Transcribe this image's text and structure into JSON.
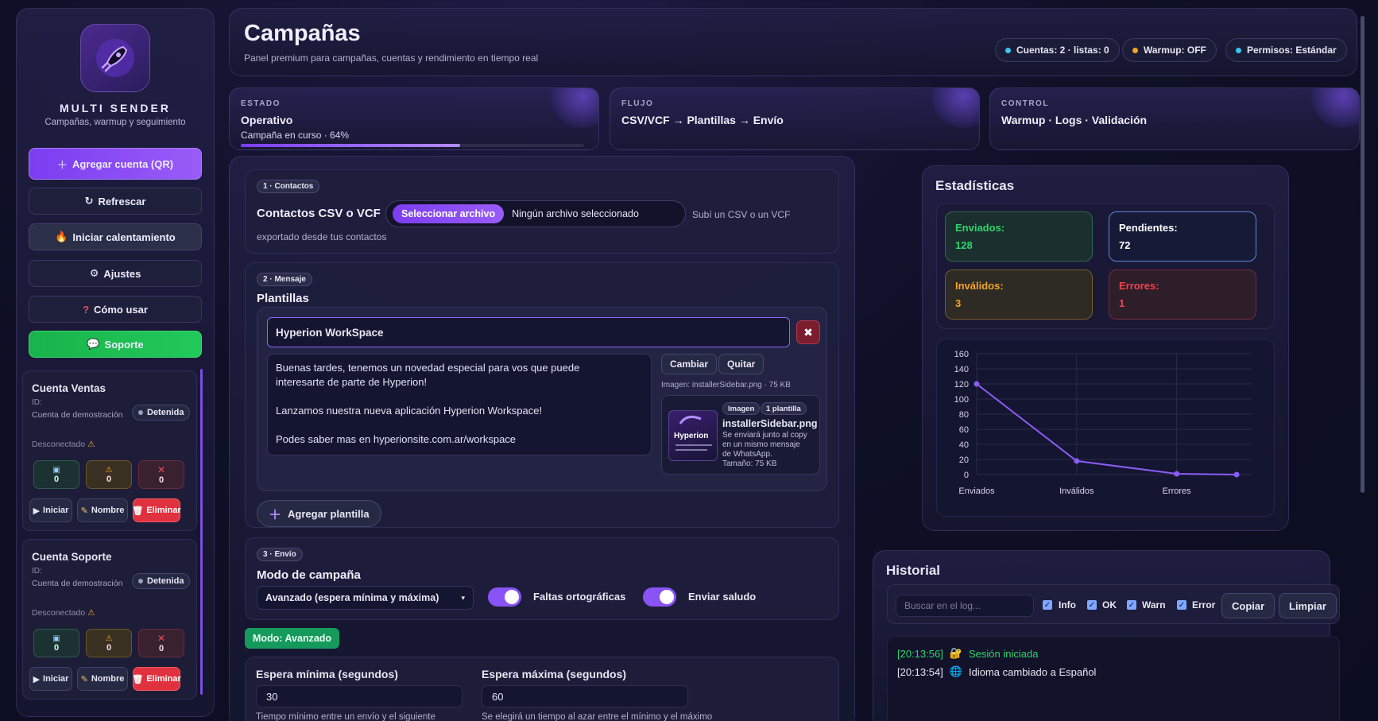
{
  "sidebar": {
    "brand": "MULTI SENDER",
    "brand_sub": "Campañas, warmup y seguimiento",
    "buttons": {
      "add_account": "Agregar cuenta (QR)",
      "refresh": "Refrescar",
      "warmup": "Iniciar calentamiento",
      "settings": "Ajustes",
      "how_to": "Cómo usar",
      "support": "Soporte"
    },
    "accounts": [
      {
        "name": "Cuenta Ventas",
        "id_label": "ID:",
        "demo": "Cuenta de demostración",
        "status": "Detenida",
        "disconnected": "Desconectado",
        "ok": "0",
        "warn": "0",
        "err": "0",
        "start": "Iniciar",
        "rename": "Nombre",
        "delete": "Eliminar"
      },
      {
        "name": "Cuenta Soporte",
        "id_label": "ID:",
        "demo": "Cuenta de demostración",
        "status": "Detenida",
        "disconnected": "Desconectado",
        "ok": "0",
        "warn": "0",
        "err": "0",
        "start": "Iniciar",
        "rename": "Nombre",
        "delete": "Eliminar"
      }
    ]
  },
  "header": {
    "title": "Campañas",
    "subtitle": "Panel premium para campañas, cuentas y rendimiento en tiempo real",
    "pills": [
      {
        "text": "Cuentas: 2 · listas: 0",
        "color": "#38c6f0"
      },
      {
        "text": "Warmup: OFF",
        "color": "#f4a52a"
      },
      {
        "text": "Permisos: Estándar",
        "color": "#38c6f0"
      }
    ]
  },
  "cards": [
    {
      "label": "ESTADO",
      "value": "Operativo",
      "extra": "Campaña en curso · 64%",
      "progress": 0.64
    },
    {
      "label": "FLUJO",
      "value": "CSV/VCF → Plantillas → Envío"
    },
    {
      "label": "CONTROL",
      "value": "Warmup · Logs · Validación"
    }
  ],
  "contacts": {
    "tag": "1 · Contactos",
    "title": "Contactos CSV o VCF",
    "file_button": "Seleccionar archivo",
    "file_status": "Ningún archivo seleccionado",
    "hint_1": "Subí un CSV o un VCF",
    "hint_2": "exportado desde tus contactos"
  },
  "message": {
    "tag": "2 · Mensaje",
    "title": "Plantillas",
    "template_name": "Hyperion WorkSpace",
    "body_lines": [
      "Buenas tardes, tenemos un novedad especial para vos  que puede",
      "interesarte de parte de Hyperion!",
      "",
      "Lanzamos nuestra nueva aplicación Hyperion Workspace!",
      "",
      "Podes saber mas en hyperionsite.com.ar/workspace"
    ],
    "change": "Cambiar",
    "remove": "Quitar",
    "image_info": "Imagen: installerSidebar.png · 75 KB",
    "chip_image": "Imagen",
    "chip_tpl": "1 plantilla",
    "thumb_text": "Hyperion",
    "file_name": "installerSidebar.png",
    "desc": [
      "Se enviará junto al copy",
      "en un mismo mensaje",
      "de WhatsApp."
    ],
    "size": "Tamaño: 75 KB",
    "add_template": "Agregar plantilla"
  },
  "send": {
    "tag": "3 · Envío",
    "title": "Modo de campaña",
    "mode": "Avanzado (espera mínima y máxima)",
    "toggle_1": "Faltas ortográficas",
    "toggle_2": "Enviar saludo",
    "mode_badge": "Modo: Avanzado",
    "min_label": "Espera mínima (segundos)",
    "min_value": "30",
    "min_hint": "Tiempo mínimo entre un envío y el siguiente",
    "max_label": "Espera máxima (segundos)",
    "max_value": "60",
    "max_hint": "Se elegirá un tiempo al azar entre el mínimo y el máximo"
  },
  "stats": {
    "title": "Estadísticas",
    "sent_label": "Enviados:",
    "sent": "128",
    "pending_label": "Pendientes:",
    "pending": "72",
    "invalid_label": "Inválidos:",
    "invalid": "3",
    "errors_label": "Errores:",
    "errors": "1",
    "colors": {
      "sent": "#2fd46b",
      "pending": "#ffffff",
      "invalid": "#f4a52a",
      "errors": "#f0424e"
    }
  },
  "chart_data": {
    "type": "line",
    "categories": [
      "Enviados",
      "Inválidos",
      "Errores"
    ],
    "x": [
      0,
      1,
      2,
      2.6
    ],
    "values": [
      120,
      18,
      1,
      0
    ],
    "yticks": [
      0,
      20,
      40,
      60,
      80,
      100,
      120,
      140,
      160
    ],
    "ylim": [
      0,
      160
    ],
    "color": "#8b5cf6",
    "grid": true
  },
  "history": {
    "title": "Historial",
    "search_placeholder": "Buscar en el log...",
    "filters": [
      "Info",
      "OK",
      "Warn",
      "Error"
    ],
    "copy": "Copiar",
    "clear": "Limpiar",
    "logs": [
      {
        "time": "[20:13:56]",
        "icon": "🔐",
        "text": "Sesión iniciada",
        "color": "#2fd46b"
      },
      {
        "time": "[20:13:54]",
        "icon": "🌐",
        "text": "Idioma cambiado a Español",
        "color": "#e8e6f3"
      }
    ]
  }
}
